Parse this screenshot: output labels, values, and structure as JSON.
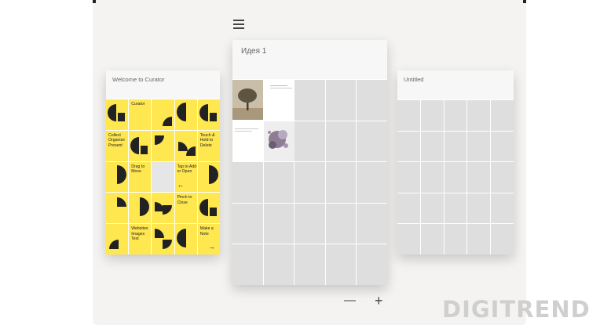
{
  "cards": {
    "welcome": {
      "title": "Welcome to Curator"
    },
    "idea": {
      "title": "Идея 1"
    },
    "untitled": {
      "title": "Untitled"
    }
  },
  "welcome_tiles": {
    "curator": "Curator",
    "collect": "Collect Organize Present",
    "touch": "Touch & Hold to Delete",
    "drag": "Drag to Move",
    "tap": "Tap to Add or Open",
    "pinch": "Pinch to Close",
    "websites": "Websites Images Text",
    "note": "Make a Note"
  },
  "icons": {
    "menu": "hamburger-menu-icon",
    "zoom_out": "minus-icon",
    "zoom_in": "plus-icon",
    "arrow_left": "arrow-left-icon",
    "arrow_right": "arrow-right-icon"
  },
  "controls": {
    "zoom_out": "—",
    "zoom_in": "+"
  },
  "watermark": "DIGITRENDS",
  "colors": {
    "accent_yellow": "#ffe750",
    "background": "#f4f3f1",
    "tile_gray": "#dedede"
  }
}
